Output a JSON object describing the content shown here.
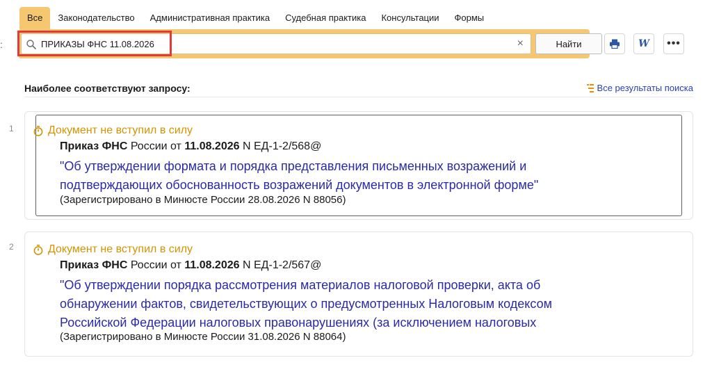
{
  "left_glyph": ":",
  "tabs": [
    {
      "label": "Все",
      "active": true
    },
    {
      "label": "Законодательство",
      "active": false
    },
    {
      "label": "Административная практика",
      "active": false
    },
    {
      "label": "Судебная практика",
      "active": false
    },
    {
      "label": "Консультации",
      "active": false
    },
    {
      "label": "Формы",
      "active": false
    }
  ],
  "search": {
    "value": "ПРИКАЗЫ ФНС 11.08.2026",
    "clear_glyph": "×",
    "button_label": "Найти"
  },
  "toolbar": {
    "print_icon": "print-icon",
    "word_glyph": "W",
    "more_glyph": "•••"
  },
  "section": {
    "title": "Наиболее соответствуют запросу:",
    "all_results_label": "Все результаты поиска"
  },
  "results": [
    {
      "number": "1",
      "status": "Документ не вступил в силу",
      "doc_type": "Приказ ФНС",
      "issuer_text": " России от ",
      "date": "11.08.2026",
      "doc_number": " N ЕД-1-2/568@",
      "title_line1": "\"Об утверждении формата и порядка представления письменных возражений и",
      "title_line2": "подтверждающих обоснованность возражений документов в электронной форме\"",
      "title_line3": "",
      "registration": "(Зарегистрировано в Минюсте России 28.08.2026 N 88056)"
    },
    {
      "number": "2",
      "status": "Документ не вступил в силу",
      "doc_type": "Приказ ФНС",
      "issuer_text": " России от ",
      "date": "11.08.2026",
      "doc_number": " N ЕД-1-2/567@",
      "title_line1": "\"Об утверждении порядка рассмотрения материалов налоговой проверки, акта об",
      "title_line2": "обнаружении фактов, свидетельствующих о предусмотренных Налоговым кодексом",
      "title_line3": "Российской Федерации налоговых правонарушениях (за исключением налоговых",
      "registration": "(Зарегистрировано в Минюсте России 31.08.2026 N 88064)"
    }
  ],
  "colors": {
    "accent": "#f6c771",
    "status": "#d39400",
    "link": "#2a2aa8",
    "highlight": "#e53935"
  }
}
